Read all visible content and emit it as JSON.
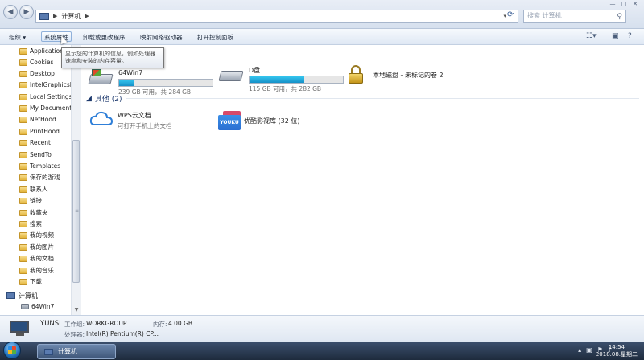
{
  "window": {
    "address_segment": "计算机",
    "search_placeholder": "搜索 计算机"
  },
  "toolbar": {
    "organize": "组织 ▾",
    "system_properties": "系统属性",
    "uninstall": "卸载或更改程序",
    "map_drive": "映射网络驱动器",
    "control_panel": "打开控制面板"
  },
  "sidebar": {
    "items": [
      "Application",
      "Cookies",
      "Desktop",
      "IntelGraphicsI",
      "Local Settings",
      "My Document",
      "NetHood",
      "PrintHood",
      "Recent",
      "SendTo",
      "Templates",
      "保存的游戏",
      "联系人",
      "链接",
      "收藏夹",
      "搜索",
      "我的视频",
      "我的图片",
      "我的文档",
      "我的音乐",
      "下载"
    ],
    "computer": "计算机",
    "drive": "64Win7"
  },
  "main": {
    "drives": [
      {
        "name": "64Win7",
        "free_text": "239 GB 可用，共 284 GB",
        "used_fraction": 0.16
      },
      {
        "name": "D盘",
        "free_text": "115 GB 可用，共 282 GB",
        "used_fraction": 0.59
      }
    ],
    "locked_drive": "本地磁盘 - 未标记的卷 2",
    "other_section": "其他 (2)",
    "other_items": [
      {
        "title": "WPS云文档",
        "subtitle": "可打开手机上的文档"
      },
      {
        "title": "优酷影视库 (32 位)",
        "subtitle": ""
      }
    ],
    "youku_logo": "YOUKU"
  },
  "tooltip": {
    "line1": "显示您的计算机的信息，例如处理器",
    "line2": "速度和安装的内存容量。"
  },
  "details": {
    "computer_name": "YUNSI",
    "workgroup_label": "工作组:",
    "workgroup_value": "WORKGROUP",
    "memory_label": "内存:",
    "memory_value": "4.00 GB",
    "processor_label": "处理器:",
    "processor_value": "Intel(R) Pentium(R) CP..."
  },
  "taskbar": {
    "window_label": "计算机",
    "time": "14:54",
    "date": "2018.08.星期二"
  }
}
